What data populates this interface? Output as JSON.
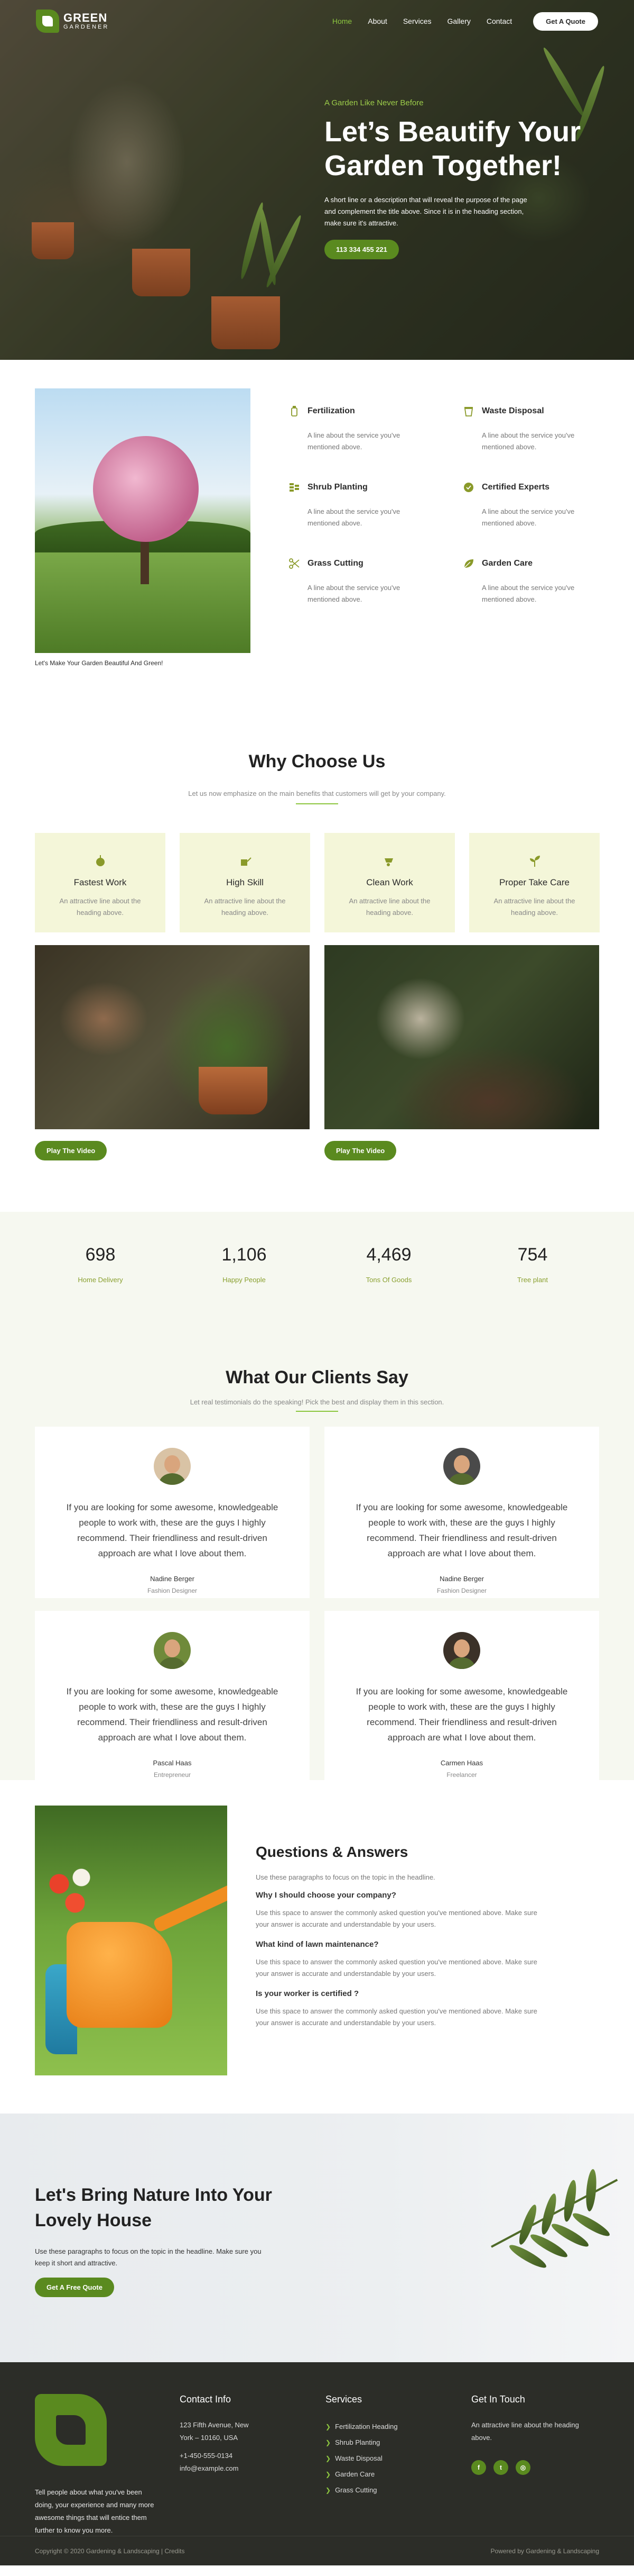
{
  "brand": {
    "name": "GREEN",
    "tagline": "GARDENER"
  },
  "nav": {
    "items": [
      {
        "label": "Home",
        "active": true
      },
      {
        "label": "About"
      },
      {
        "label": "Services"
      },
      {
        "label": "Gallery"
      },
      {
        "label": "Contact"
      }
    ],
    "cta_label": "Get A Quote"
  },
  "hero": {
    "kicker": "A Garden Like Never Before",
    "title": "Let’s Beautify Your Garden Together!",
    "description": "A short line or a description that will reveal the purpose of the page and complement the title above. Since it is in the heading section, make sure it's attractive.",
    "button_label": "113 334 455 221"
  },
  "services": {
    "image_caption": "Let's Make Your Garden Beautiful And Green!",
    "items": [
      {
        "title": "Fertilization",
        "text": "A line about the service you've mentioned above.",
        "icon": "fertilizer-icon"
      },
      {
        "title": "Waste Disposal",
        "text": "A line about the service you've mentioned above.",
        "icon": "trash-icon"
      },
      {
        "title": "Shrub Planting",
        "text": "A line about the service you've mentioned above.",
        "icon": "shrub-icon"
      },
      {
        "title": "Certified Experts",
        "text": "A line about the service you've mentioned above.",
        "icon": "badge-icon"
      },
      {
        "title": "Grass Cutting",
        "text": "A line about the service you've mentioned above.",
        "icon": "scissors-icon"
      },
      {
        "title": "Garden Care",
        "text": "A line about the service you've mentioned above.",
        "icon": "leaf-icon"
      }
    ]
  },
  "why": {
    "title": "Why Choose Us",
    "subtitle": "Let us now emphasize on the main benefits that customers will get by your company.",
    "cards": [
      {
        "title": "Fastest Work",
        "text": "An attractive line about the heading above.",
        "icon": "plant-icon"
      },
      {
        "title": "High Skill",
        "text": "An attractive line about the heading above.",
        "icon": "watering-can-icon"
      },
      {
        "title": "Clean Work",
        "text": "An attractive line about the heading above.",
        "icon": "wheelbarrow-icon"
      },
      {
        "title": "Proper Take Care",
        "text": "An attractive line about the heading above.",
        "icon": "seedling-icon"
      }
    ],
    "video_button": "Play The Video"
  },
  "stats": [
    {
      "value": "698",
      "label": "Home Delivery"
    },
    {
      "value": "1,106",
      "label": "Happy People"
    },
    {
      "value": "4,469",
      "label": "Tons Of Goods"
    },
    {
      "value": "754",
      "label": "Tree plant"
    }
  ],
  "clients": {
    "title": "What Our Clients Say",
    "subtitle": "Let real testimonials do the speaking! Pick the best and display them in this section.",
    "testimonials": [
      {
        "quote": "If you are looking for some awesome, knowledgeable people to work with, these are the guys I highly recommend. Their friendliness and result-driven approach are what I love about them.",
        "name": "Nadine Berger",
        "role": "Fashion Designer"
      },
      {
        "quote": "If you are looking for some awesome, knowledgeable people to work with, these are the guys I highly recommend. Their friendliness and result-driven approach are what I love about them.",
        "name": "Nadine Berger",
        "role": "Fashion Designer"
      },
      {
        "quote": "If you are looking for some awesome, knowledgeable people to work with, these are the guys I highly recommend. Their friendliness and result-driven approach are what I love about them.",
        "name": "Pascal Haas",
        "role": "Entrepreneur"
      },
      {
        "quote": "If you are looking for some awesome, knowledgeable people to work with, these are the guys I highly recommend. Their friendliness and result-driven approach are what I love about them.",
        "name": "Carmen Haas",
        "role": "Freelancer"
      }
    ]
  },
  "faq": {
    "title": "Questions & Answers",
    "intro": "Use these paragraphs to focus on the topic in the headline.",
    "items": [
      {
        "q": "Why I should choose your company?",
        "a": "Use this space to answer the commonly asked question you've mentioned above. Make sure your answer is accurate and understandable by your users."
      },
      {
        "q": "What kind of lawn maintenance?",
        "a": "Use this space to answer the commonly asked question you've mentioned above. Make sure your answer is accurate and understandable by your users."
      },
      {
        "q": "Is your worker is certified ?",
        "a": "Use this space to answer the commonly asked question you've mentioned above. Make sure your answer is accurate and understandable by your users."
      }
    ]
  },
  "cta": {
    "title": "Let's Bring Nature Into Your Lovely House",
    "text": "Use these paragraphs to focus on the topic in the headline. Make sure you keep it short and attractive.",
    "button_label": "Get A Free Quote"
  },
  "footer": {
    "about": "Tell people about what you've been doing, your experience and many more awesome things that will entice them further to know you more.",
    "contact": {
      "title": "Contact Info",
      "address": "123 Fifth Avenue, New York – 10160, USA",
      "phone": "+1-450-555-0134",
      "email": "info@example.com"
    },
    "services": {
      "title": "Services",
      "items": [
        "Fertilization Heading",
        "Shrub Planting",
        "Waste Disposal",
        "Garden Care",
        "Grass Cutting"
      ]
    },
    "touch": {
      "title": "Get In Touch",
      "text": "An attractive line about the heading above.",
      "socials": [
        {
          "icon": "facebook-icon",
          "glyph": "f"
        },
        {
          "icon": "twitter-icon",
          "glyph": "t"
        },
        {
          "icon": "instagram-icon",
          "glyph": "◎"
        }
      ]
    },
    "copyright": "Copyright © 2020 Gardening & Landscaping | Credits",
    "powered": "Powered by Gardening & Landscaping"
  },
  "colors": {
    "accent": "#5a8a1f",
    "accent_light": "#8cc63f",
    "card_bg": "#f4f6d9",
    "stats_bg": "#f6f8f0",
    "footer_bg": "#2c2d28"
  }
}
